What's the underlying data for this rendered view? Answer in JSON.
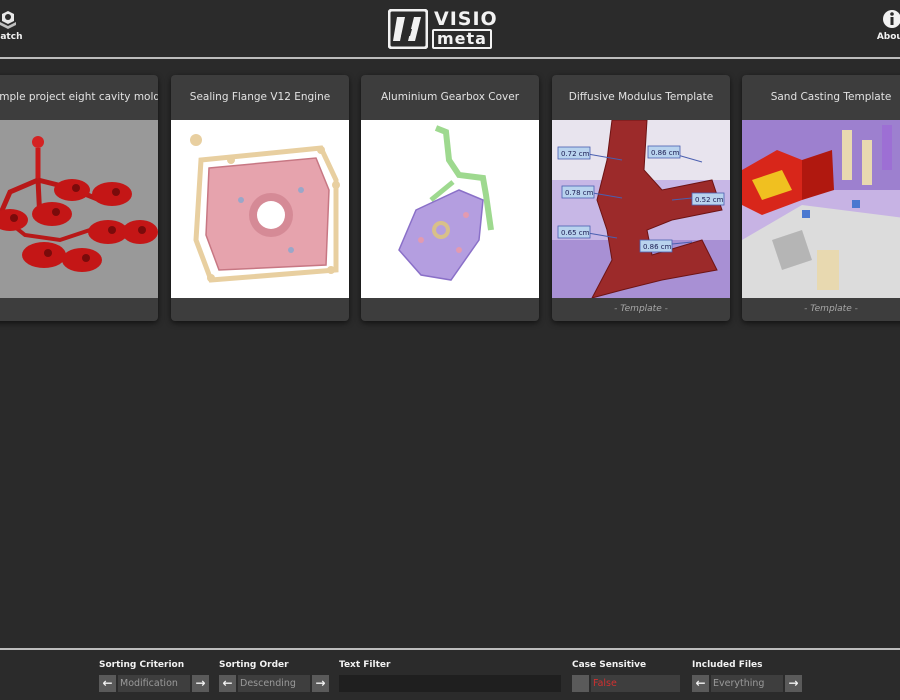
{
  "header": {
    "batch_label": "Batch",
    "about_label": "About",
    "logo_top": "VISIO",
    "logo_bottom": "meta"
  },
  "cards": [
    {
      "title": "Example project eight cavity mold",
      "footer": ""
    },
    {
      "title": "Sealing Flange V12 Engine",
      "footer": ""
    },
    {
      "title": "Aluminium Gearbox Cover",
      "footer": ""
    },
    {
      "title": "Diffusive Modulus Template",
      "footer": "- Template -",
      "measurements": [
        "0.72 cm",
        "0.86 cm",
        "0.78 cm",
        "0.52 cm",
        "0.65 cm",
        "0.86 cm"
      ]
    },
    {
      "title": "Sand Casting Template",
      "footer": "- Template -"
    }
  ],
  "controls": {
    "sorting_criterion": {
      "label": "Sorting Criterion",
      "value": "Modification"
    },
    "sorting_order": {
      "label": "Sorting Order",
      "value": "Descending"
    },
    "text_filter": {
      "label": "Text Filter",
      "value": ""
    },
    "case_sensitive": {
      "label": "Case Sensitive",
      "value": "False"
    },
    "included_files": {
      "label": "Included Files",
      "value": "Everything"
    }
  },
  "colors": {
    "background": "#2a2a2a",
    "card": "#3d3d3d",
    "false_text": "#d03030",
    "separator": "#bdbdbd"
  }
}
